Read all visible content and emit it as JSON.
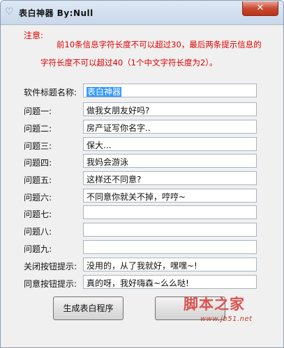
{
  "window": {
    "title": "表白神器   By:Null",
    "close_label": "✕"
  },
  "notice": {
    "label": "注意:",
    "line1": "前10条信息字符长度不可以超过30，最后两条提示信息的",
    "line2": "字符长度不可以超过40（1个中文字符长度为2）。"
  },
  "form": {
    "title_field": {
      "label": "软件标题名称:",
      "value": "表白神器"
    },
    "questions": [
      {
        "label": "问题一:",
        "value": "做我女朋友好吗?"
      },
      {
        "label": "问题二:",
        "value": "房产证写你名字.."
      },
      {
        "label": "问题三:",
        "value": "保大..."
      },
      {
        "label": "问题四:",
        "value": "我妈会游泳"
      },
      {
        "label": "问题五:",
        "value": "这样还不同意?"
      },
      {
        "label": "问题六:",
        "value": "不同意你就关不掉，哼哼~"
      },
      {
        "label": "问题七:",
        "value": ""
      },
      {
        "label": "问题八:",
        "value": ""
      },
      {
        "label": "问题九:",
        "value": ""
      }
    ],
    "close_hint": {
      "label": "关闭按钮提示:",
      "value": "没用的，从了我就好，嘿嘿~!"
    },
    "agree_hint": {
      "label": "同意按钮提示:",
      "value": "真的呀，我好嗨森~么么哒!"
    }
  },
  "buttons": {
    "generate": "生成表白程序",
    "second": ""
  },
  "watermark": {
    "text": "脚本之家",
    "url": "www.jb51.net"
  }
}
